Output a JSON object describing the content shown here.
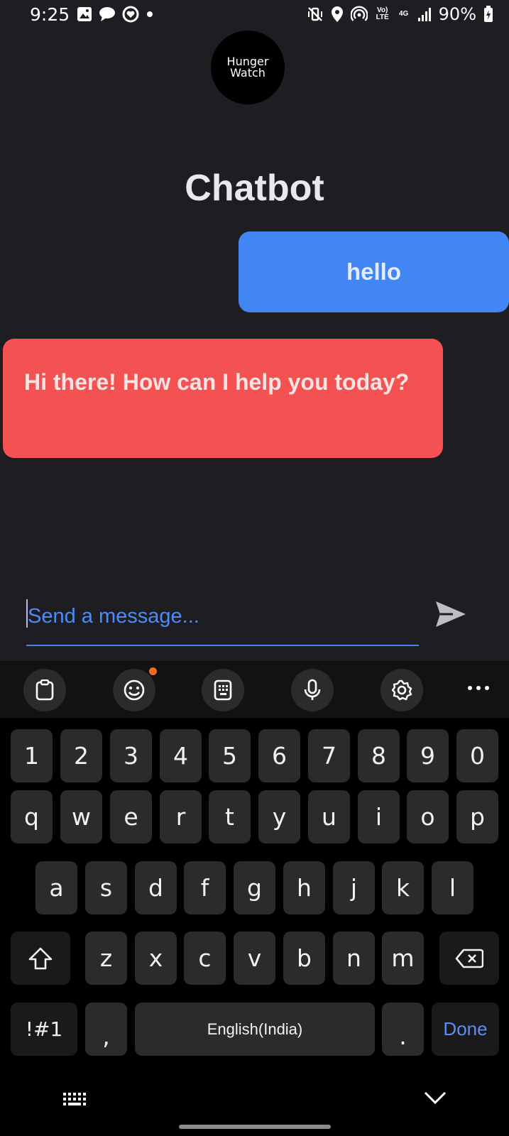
{
  "status_bar": {
    "time": "9:25",
    "battery": "90%",
    "volte": "Vo) LTE",
    "network": "4G",
    "icons": [
      "gallery-icon",
      "chat-bubble-icon",
      "heart-circle-icon",
      "dot-icon",
      "mute-vibrate-icon",
      "location-icon",
      "hotspot-icon",
      "signal-icon",
      "battery-charging-icon"
    ]
  },
  "logo": {
    "line1": "Hunger",
    "line2": "Watch"
  },
  "header": {
    "title": "Chatbot"
  },
  "messages": [
    {
      "sender": "user",
      "text": "hello",
      "color": "#4286f4"
    },
    {
      "sender": "bot",
      "text": "Hi there! How can I help you today?",
      "color": "#f45252"
    }
  ],
  "composer": {
    "placeholder": "Send a message...",
    "value": ""
  },
  "keyboard": {
    "toolbar": [
      "clipboard-icon",
      "emoji-icon",
      "keypad-icon",
      "microphone-icon",
      "settings-icon",
      "more-icon"
    ],
    "row_numbers": [
      "1",
      "2",
      "3",
      "4",
      "5",
      "6",
      "7",
      "8",
      "9",
      "0"
    ],
    "row_top": [
      "q",
      "w",
      "e",
      "r",
      "t",
      "y",
      "u",
      "i",
      "o",
      "p"
    ],
    "row_middle": [
      "a",
      "s",
      "d",
      "f",
      "g",
      "h",
      "j",
      "k",
      "l"
    ],
    "row_bottom": [
      "z",
      "x",
      "c",
      "v",
      "b",
      "n",
      "m"
    ],
    "symbols_label": "!#1",
    "comma": ",",
    "space_label": "English(India)",
    "period": ".",
    "done_label": "Done"
  },
  "colors": {
    "background": "#1e1e22",
    "accent": "#4286f4",
    "bot_bubble": "#f45252",
    "notification_dot": "#f26b21"
  }
}
